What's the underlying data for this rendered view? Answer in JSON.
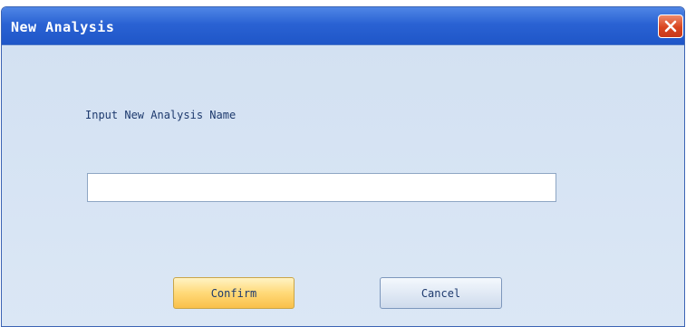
{
  "dialog": {
    "title": "New Analysis",
    "close_icon": "close-icon",
    "prompt_label": "Input New Analysis Name",
    "name_input_value": "",
    "confirm_label": "Confirm",
    "cancel_label": "Cancel"
  },
  "colors": {
    "titlebar": "#2a62d3",
    "close_button": "#d9451f",
    "body_background": "#d8e5f4",
    "confirm_button": "#ffd978",
    "cancel_button": "#dfe8f4"
  }
}
